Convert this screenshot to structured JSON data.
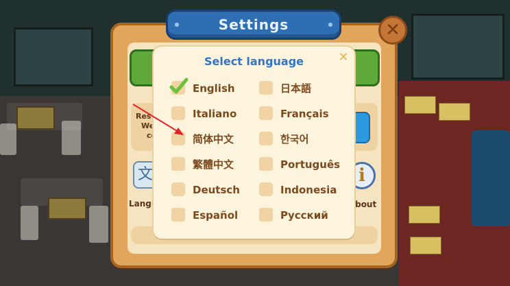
{
  "settings": {
    "title": "Settings",
    "close_symbol": "✕",
    "language_label": "Langu",
    "about_label": "about",
    "resume_lines": [
      "Res",
      "We",
      "co"
    ],
    "language_icon": "文",
    "info_icon": "i"
  },
  "dialog": {
    "title": "Select language",
    "close_symbol": "✕",
    "languages": [
      {
        "label": "English",
        "checked": true
      },
      {
        "label": "日本語",
        "checked": false
      },
      {
        "label": "Italiano",
        "checked": false
      },
      {
        "label": "Français",
        "checked": false
      },
      {
        "label": "简体中文",
        "checked": false
      },
      {
        "label": "한국어",
        "checked": false
      },
      {
        "label": "繁體中文",
        "checked": false
      },
      {
        "label": "Português",
        "checked": false
      },
      {
        "label": "Deutsch",
        "checked": false
      },
      {
        "label": "Indonesia",
        "checked": false
      },
      {
        "label": "Español",
        "checked": false
      },
      {
        "label": "Русский",
        "checked": false
      }
    ]
  },
  "colors": {
    "accent_blue": "#3474c2",
    "check_green": "#6cc13a",
    "annotation_red": "#e0252a"
  }
}
